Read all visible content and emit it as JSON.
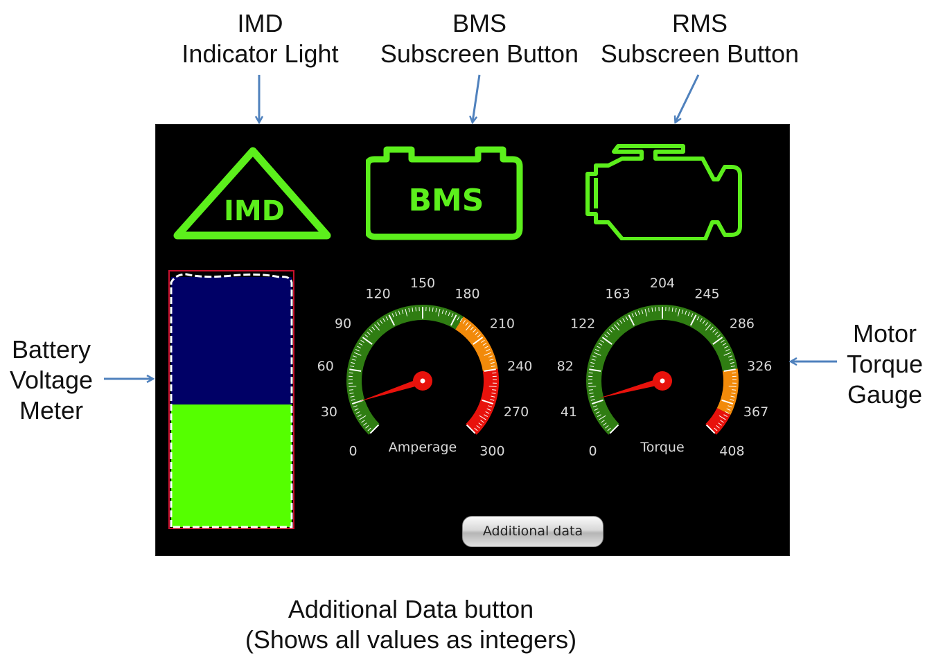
{
  "callouts": {
    "imd": [
      "IMD",
      "Indicator Light"
    ],
    "bms": [
      "BMS",
      "Subscreen Button"
    ],
    "rms": [
      "RMS",
      "Subscreen Button"
    ],
    "battery": [
      "Battery",
      "Voltage",
      "Meter"
    ],
    "torque": [
      "Motor",
      "Torque",
      "Gauge"
    ],
    "additional": [
      "Additional Data button",
      "(Shows all values as integers)"
    ]
  },
  "icons": {
    "imd_label": "IMD",
    "bms_label": "BMS",
    "icon_color": "#5cef1c"
  },
  "gauges": [
    {
      "id": "amperage",
      "title": "Amperage",
      "min": 0,
      "max": 300,
      "tick_labels": [
        "0",
        "30",
        "60",
        "90",
        "120",
        "150",
        "180",
        "210",
        "240",
        "270",
        "300"
      ],
      "value": 30,
      "zones": [
        {
          "from": 0,
          "to": 186,
          "color": "#2f7d12"
        },
        {
          "from": 186,
          "to": 240,
          "color": "#f28a0a"
        },
        {
          "from": 240,
          "to": 300,
          "color": "#e8120c"
        }
      ]
    },
    {
      "id": "torque",
      "title": "Torque",
      "min": 0,
      "max": 408,
      "tick_labels": [
        "0",
        "41",
        "82",
        "122",
        "163",
        "204",
        "245",
        "286",
        "326",
        "367",
        "408"
      ],
      "value": 45,
      "zones": [
        {
          "from": 0,
          "to": 326,
          "color": "#2f7d12"
        },
        {
          "from": 326,
          "to": 380,
          "color": "#f28a0a"
        },
        {
          "from": 380,
          "to": 408,
          "color": "#e8120c"
        }
      ]
    }
  ],
  "battery_meter": {
    "level_fraction": 0.49,
    "fill_color": "#55ff00",
    "empty_color": "#000066"
  },
  "additional_button": {
    "label": "Additional data"
  }
}
